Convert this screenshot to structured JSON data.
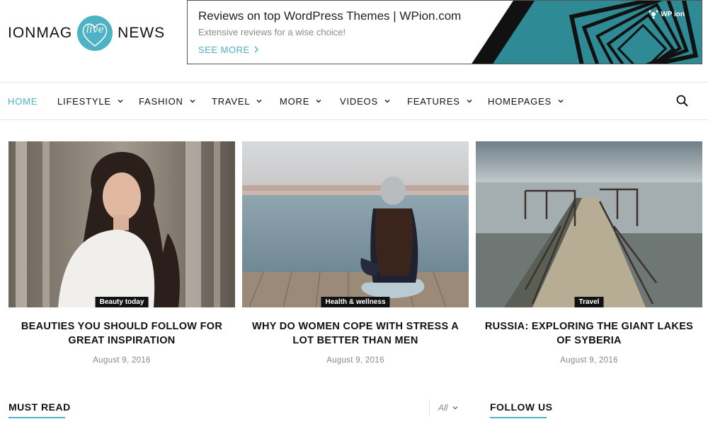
{
  "logo": {
    "left": "IONMAG",
    "center": "live",
    "right": "NEWS"
  },
  "banner": {
    "title": "Reviews on top WordPress Themes | WPion.com",
    "subtitle": "Extensive reviews for a wise choice!",
    "cta": "SEE MORE",
    "brand": "WP ion"
  },
  "nav": {
    "items": [
      {
        "label": "HOME",
        "active": true,
        "dropdown": false
      },
      {
        "label": "LIFESTYLE",
        "active": false,
        "dropdown": true
      },
      {
        "label": "FASHION",
        "active": false,
        "dropdown": true
      },
      {
        "label": "TRAVEL",
        "active": false,
        "dropdown": true
      },
      {
        "label": "MORE",
        "active": false,
        "dropdown": true
      },
      {
        "label": "VIDEOS",
        "active": false,
        "dropdown": true
      },
      {
        "label": "FEATURES",
        "active": false,
        "dropdown": true
      },
      {
        "label": "HOMEPAGES",
        "active": false,
        "dropdown": true
      }
    ],
    "search_icon": "search-icon"
  },
  "articles": [
    {
      "category": "Beauty today",
      "title": "BEAUTIES YOU SHOULD FOLLOW FOR GREAT INSPIRATION",
      "date": "August 9, 2016"
    },
    {
      "category": "Health & wellness",
      "title": "WHY DO WOMEN COPE WITH STRESS A LOT BETTER THAN MEN",
      "date": "August 9, 2016"
    },
    {
      "category": "Travel",
      "title": "RUSSIA: EXPLORING THE GIANT LAKES OF SYBERIA",
      "date": "August 9, 2016"
    }
  ],
  "sections": {
    "must_read": "MUST READ",
    "filter": "All",
    "follow_us": "FOLLOW US"
  },
  "colors": {
    "accent": "#4db2c4",
    "text": "#111111",
    "muted": "#888888",
    "badge_bg": "#111111"
  }
}
